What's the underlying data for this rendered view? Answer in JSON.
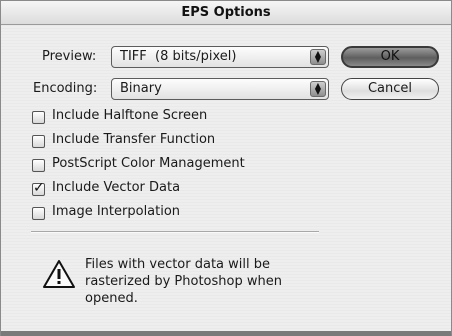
{
  "window": {
    "title": "EPS Options"
  },
  "preview": {
    "label": "Preview:",
    "value": "TIFF  (8 bits/pixel)"
  },
  "encoding": {
    "label": "Encoding:",
    "value": "Binary"
  },
  "buttons": {
    "ok": "OK",
    "cancel": "Cancel"
  },
  "options": [
    {
      "label": "Include Halftone Screen",
      "checked": false
    },
    {
      "label": "Include Transfer Function",
      "checked": false
    },
    {
      "label": "PostScript Color Management",
      "checked": false
    },
    {
      "label": "Include Vector Data",
      "checked": true
    },
    {
      "label": "Image Interpolation",
      "checked": false
    }
  ],
  "warning": {
    "icon": "warning-triangle-icon",
    "text": "Files with vector data will be\nrasterized by Photoshop when\nopened."
  }
}
